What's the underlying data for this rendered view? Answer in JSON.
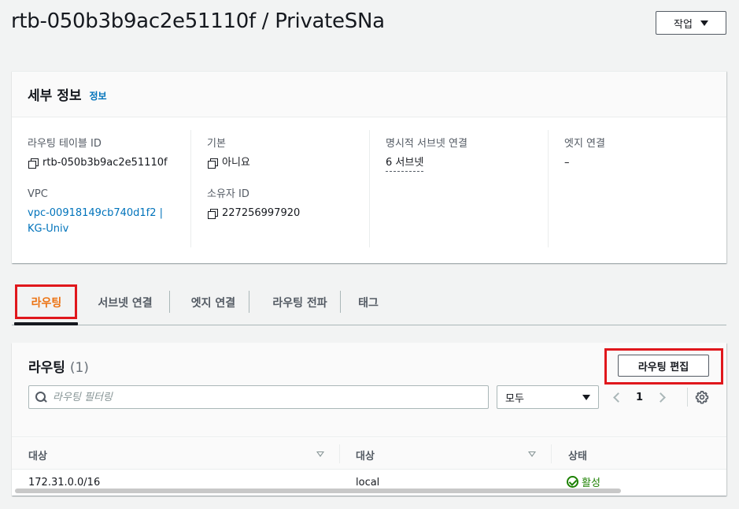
{
  "header": {
    "title": "rtb-050b3b9ac2e51110f / PrivateSNa",
    "actions_label": "작업"
  },
  "details": {
    "title": "세부 정보",
    "info_link": "정보",
    "route_table_id_label": "라우팅 테이블 ID",
    "route_table_id_value": "rtb-050b3b9ac2e51110f",
    "vpc_label": "VPC",
    "vpc_value_line1": "vpc-00918149cb740d1f2 |",
    "vpc_value_line2": "KG-Univ",
    "main_label": "기본",
    "main_value": "아니요",
    "owner_id_label": "소유자 ID",
    "owner_id_value": "227256997920",
    "explicit_subnet_label": "명시적 서브넷 연결",
    "explicit_subnet_value": "6 서브넷",
    "edge_assoc_label": "엣지 연결",
    "edge_assoc_value": "–"
  },
  "tabs": [
    {
      "label": "라우팅",
      "active": true
    },
    {
      "label": "서브넷 연결",
      "active": false
    },
    {
      "label": "엣지 연결",
      "active": false
    },
    {
      "label": "라우팅 전파",
      "active": false
    },
    {
      "label": "태그",
      "active": false
    }
  ],
  "routes": {
    "title": "라우팅",
    "count": "(1)",
    "edit_button": "라우팅 편집",
    "search_placeholder": "라우팅 필터링",
    "filter_select": "모두",
    "page": "1",
    "columns": [
      "대상",
      "대상",
      "상태"
    ],
    "rows": [
      {
        "destination": "172.31.0.0/16",
        "target": "local",
        "status": "활성"
      }
    ]
  },
  "colors": {
    "accent_orange": "#ec7211",
    "link_blue": "#0073bb",
    "status_green": "#1d8102",
    "highlight_red": "#e0171c"
  },
  "icons": [
    "copy-icon",
    "caret-down-icon",
    "search-icon",
    "chevron-left-icon",
    "chevron-right-icon",
    "gear-icon",
    "check-circle-icon",
    "sort-icon"
  ]
}
